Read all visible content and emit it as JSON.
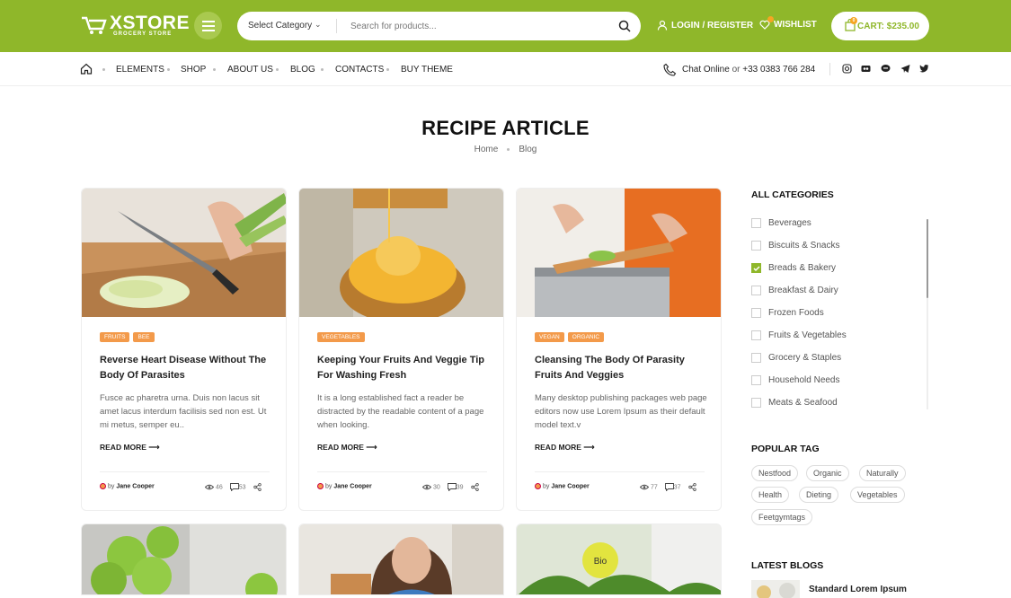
{
  "header": {
    "logo_title": "XSTORE",
    "logo_sub": "GROCERY STORE",
    "category_label": "Select Category",
    "search_placeholder": "Search for products...",
    "login_label": "LOGIN / REGISTER",
    "wishlist_label": "WISHLIST",
    "cart_label": "CART: $235.00",
    "cart_count": "0",
    "accent": "#8fb72a"
  },
  "nav": {
    "items": [
      "ELEMENTS",
      "SHOP",
      "ABOUT US",
      "BLOG",
      "CONTACTS",
      "BUY THEME"
    ],
    "chat_label": "Chat Online",
    "or": "or",
    "phone": "+33 0383 766 284",
    "social_icons": [
      "instagram-icon",
      "flickr-icon",
      "line-icon",
      "telegram-icon",
      "twitter-icon"
    ]
  },
  "page": {
    "title": "RECIPE ARTICLE",
    "breadcrumb": [
      "Home",
      "Blog"
    ]
  },
  "posts": [
    {
      "tags": [
        "FRUITS",
        "BEE"
      ],
      "title": "Reverse Heart Disease Without The Body Of Parasites",
      "excerpt": "Fusce ac pharetra urna. Duis non lacus sit amet lacus interdum facilisis sed non est. Ut mi metus, semper eu..",
      "read_more": "READ MORE",
      "by": "by",
      "author": "Jane Cooper",
      "views": "46",
      "comments": "53"
    },
    {
      "tags": [
        "VEGETABLES"
      ],
      "title": "Keeping Your Fruits And Veggie Tip For Washing Fresh",
      "excerpt": "It is a long established fact a reader be distracted by the readable content of a page when looking.",
      "read_more": "READ MORE",
      "by": "by",
      "author": "Jane Cooper",
      "views": "30",
      "comments": "39"
    },
    {
      "tags": [
        "VEGAN",
        "ORGANIC"
      ],
      "title": "Cleansing The Body Of Parasity Fruits And Veggies",
      "excerpt": "Many desktop publishing packages web page editors now use Lorem Ipsum as their default model text.v",
      "read_more": "READ MORE",
      "by": "by",
      "author": "Jane Cooper",
      "views": "77",
      "comments": "37"
    }
  ],
  "sidebar": {
    "categories_heading": "ALL CATEGORIES",
    "categories": [
      {
        "label": "Beverages",
        "checked": false
      },
      {
        "label": "Biscuits & Snacks",
        "checked": false
      },
      {
        "label": "Breads & Bakery",
        "checked": true
      },
      {
        "label": "Breakfast & Dairy",
        "checked": false
      },
      {
        "label": "Frozen Foods",
        "checked": false
      },
      {
        "label": "Fruits & Vegetables",
        "checked": false
      },
      {
        "label": "Grocery & Staples",
        "checked": false
      },
      {
        "label": "Household Needs",
        "checked": false
      },
      {
        "label": "Meats & Seafood",
        "checked": false
      }
    ],
    "tags_heading": "POPULAR TAG",
    "tags": [
      "Nestfood",
      "Organic",
      "Naturally",
      "Health",
      "Dieting",
      "Vegetables",
      "Feetgymtags"
    ],
    "latest_heading": "LATEST BLOGS",
    "latest_title": "Standard Lorem Ipsum"
  }
}
